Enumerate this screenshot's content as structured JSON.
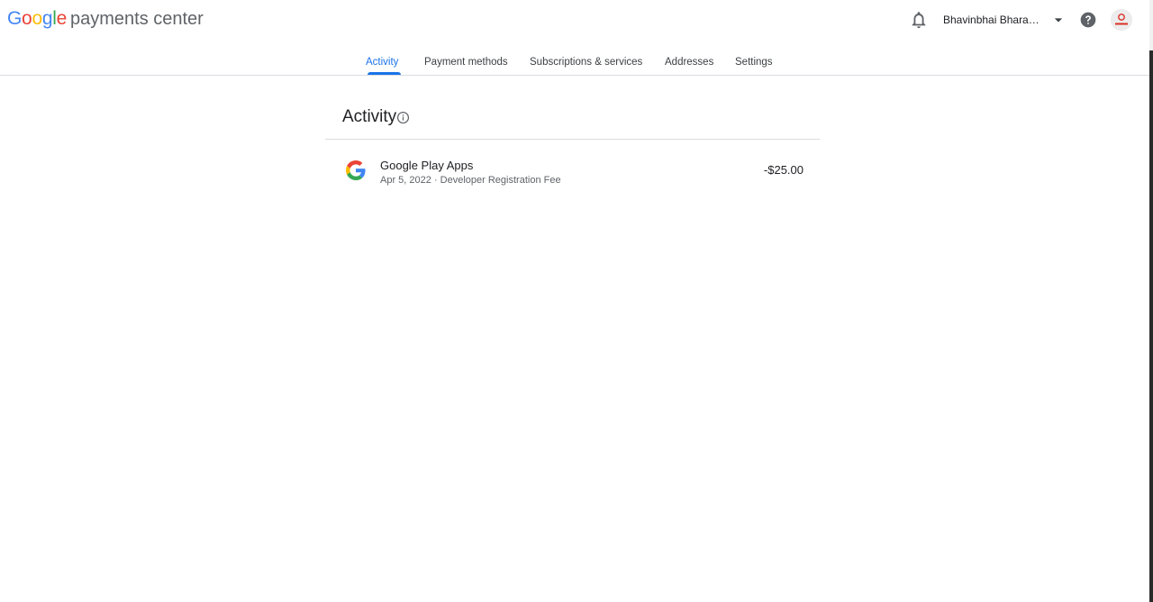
{
  "header": {
    "logo_letters": [
      {
        "char": "G",
        "color": "#4285F4"
      },
      {
        "char": "o",
        "color": "#EA4335"
      },
      {
        "char": "o",
        "color": "#FBBC05"
      },
      {
        "char": "g",
        "color": "#4285F4"
      },
      {
        "char": "l",
        "color": "#34A853"
      },
      {
        "char": "e",
        "color": "#EA4335"
      }
    ],
    "logo_product": "payments center",
    "account_name": "Bhavinbhai Bharatbhai",
    "icons": {
      "notifications": "bell-icon",
      "account_menu": "caret-down-icon",
      "help": "help-circle-icon",
      "avatar": "avatar"
    }
  },
  "tabs": [
    {
      "label": "Activity",
      "active": true
    },
    {
      "label": "Payment methods",
      "active": false
    },
    {
      "label": "Subscriptions & services",
      "active": false
    },
    {
      "label": "Addresses",
      "active": false
    },
    {
      "label": "Settings",
      "active": false
    }
  ],
  "activity": {
    "title": "Activity",
    "transactions": [
      {
        "merchant": "Google Play Apps",
        "date": "Apr 5, 2022",
        "separator": "·",
        "description": "Developer Registration Fee",
        "amount": "-$25.00",
        "icon": "google-g-icon"
      }
    ]
  },
  "colors": {
    "accent": "#1a73e8",
    "text_primary": "#202124",
    "text_secondary": "#5f6368",
    "divider": "#dadce0"
  }
}
